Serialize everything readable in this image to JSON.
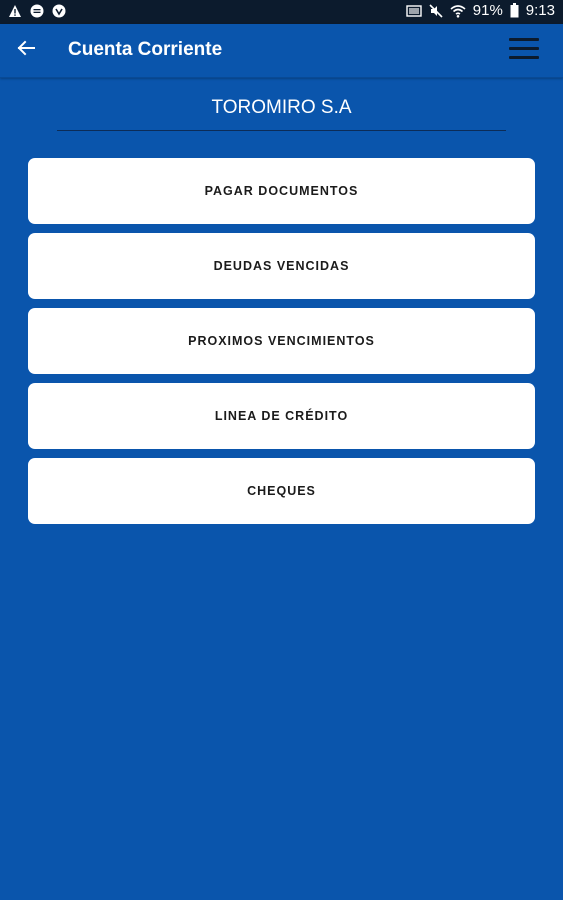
{
  "status_bar": {
    "battery": "91%",
    "time": "9:13"
  },
  "app_bar": {
    "title": "Cuenta Corriente"
  },
  "company": {
    "name": "TOROMIRO S.A"
  },
  "menu": [
    {
      "label": "PAGAR DOCUMENTOS"
    },
    {
      "label": "DEUDAS VENCIDAS"
    },
    {
      "label": "PROXIMOS VENCIMIENTOS"
    },
    {
      "label": "LINEA DE CRÉDITO"
    },
    {
      "label": "CHEQUES"
    }
  ],
  "colors": {
    "background": "#0a55ac",
    "status_bar": "#0c1b2d",
    "card": "#ffffff",
    "card_text": "#1b1b1b"
  }
}
